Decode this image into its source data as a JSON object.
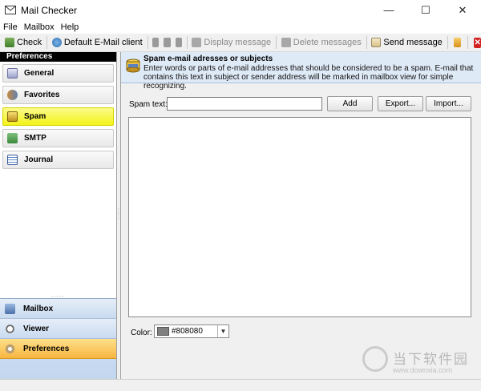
{
  "window": {
    "title": "Mail Checker",
    "minimize": "—",
    "maximize": "☐",
    "close": "✕"
  },
  "menu": [
    "File",
    "Mailbox",
    "Help"
  ],
  "toolbar": {
    "check": "Check",
    "default_client": "Default E-Mail client",
    "display_message": "Display message",
    "delete_messages": "Delete messages",
    "send_message": "Send message"
  },
  "preferences": {
    "header": "Preferences",
    "items": [
      "General",
      "Favorites",
      "Spam",
      "SMTP",
      "Journal"
    ],
    "active": "Spam"
  },
  "navigation": {
    "items": [
      "Mailbox",
      "Viewer",
      "Preferences"
    ],
    "active": "Preferences"
  },
  "spam_panel": {
    "title": "Spam e-mail adresses or subjects",
    "description": "Enter words or parts of e-mail addresses that should be considered to be a spam. E-mail that contains this text in subject or sender address will be marked in mailbox view for simple recognizing.",
    "spam_text_label": "Spam text:",
    "spam_text_value": "",
    "add_button": "Add",
    "export_button": "Export...",
    "import_button": "Import...",
    "color_label": "Color:",
    "color_value": "#808080"
  },
  "watermark": {
    "text": "当下软件园",
    "url": "www.downxia.com"
  },
  "colors": {
    "accent_yellow": "#f3f31a",
    "nav_active": "#f8b640",
    "info_bg": "#dfeaf7"
  }
}
